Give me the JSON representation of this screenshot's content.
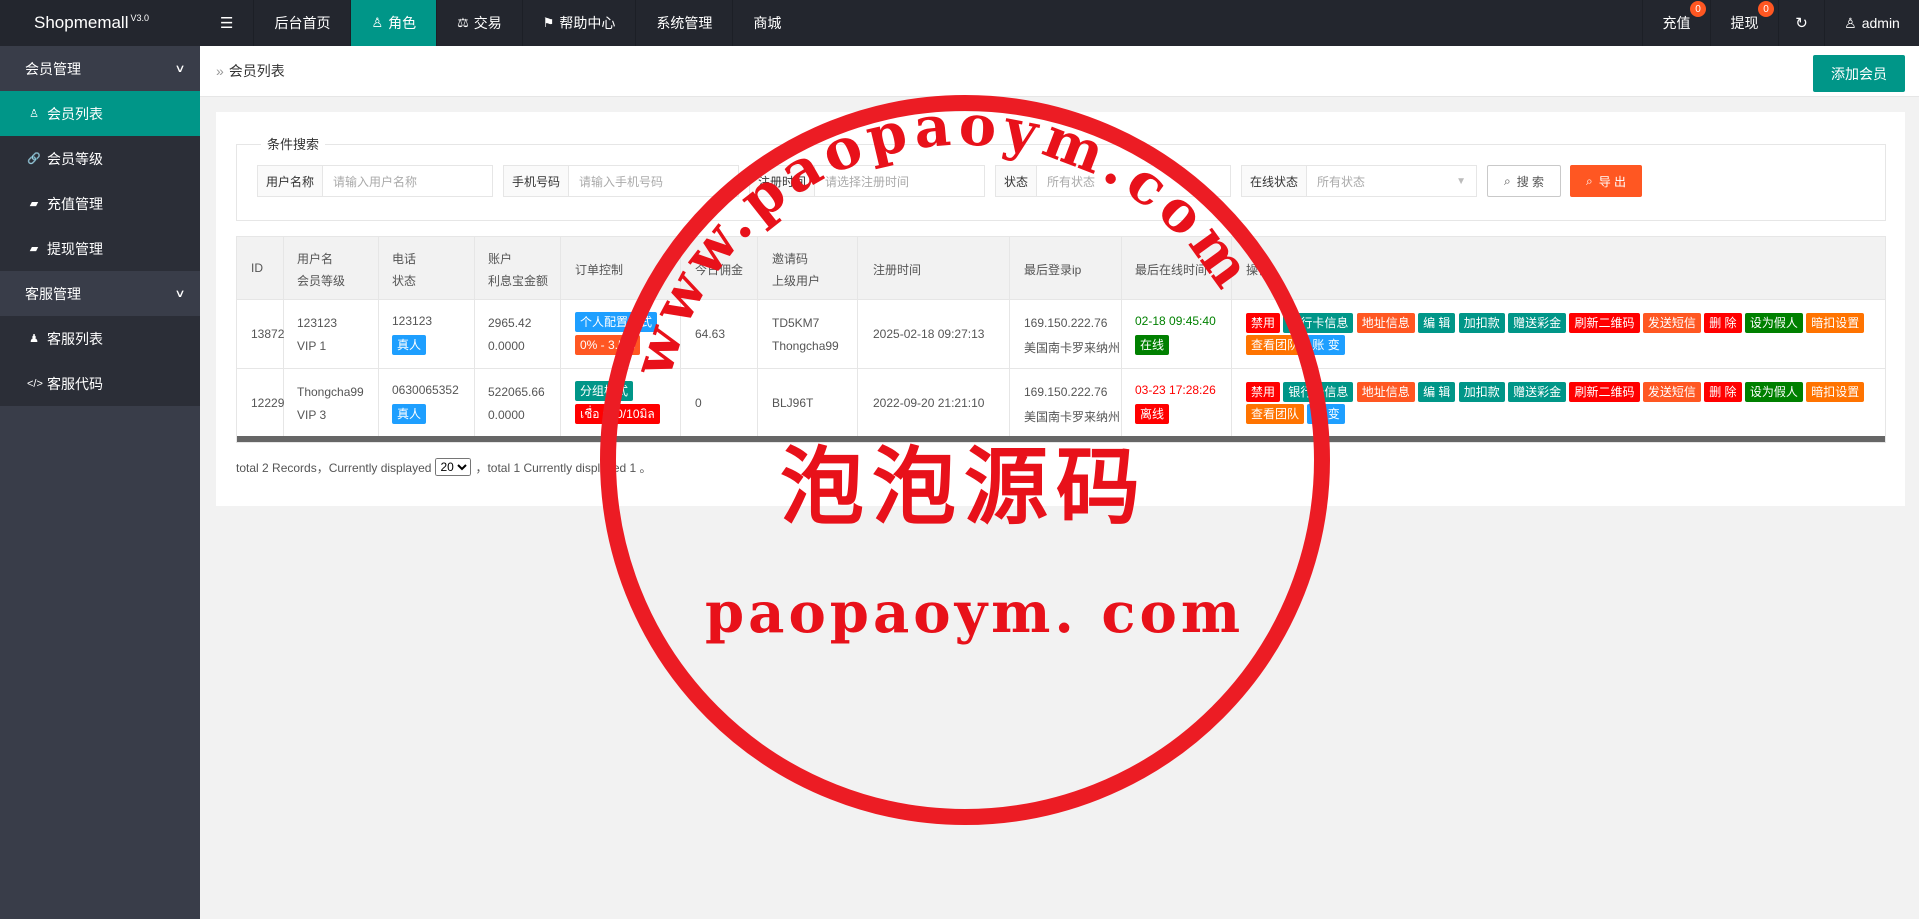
{
  "app": {
    "name": "Shopmemall",
    "version": "V3.0"
  },
  "topnav": {
    "menu_icon": "menu-icon",
    "items": [
      {
        "label": "后台首页"
      },
      {
        "label": "角色",
        "icon": "user-icon",
        "active": true
      },
      {
        "label": "交易",
        "icon": "scale-icon"
      },
      {
        "label": "帮助中心",
        "icon": "flag-icon"
      },
      {
        "label": "系统管理"
      },
      {
        "label": "商城"
      }
    ],
    "recharge": {
      "label": "充值",
      "badge": "0"
    },
    "withdraw": {
      "label": "提现",
      "badge": "0"
    },
    "refresh_icon": "refresh-icon",
    "user": {
      "label": "admin",
      "icon": "user-icon"
    }
  },
  "sidebar": {
    "groups": [
      {
        "label": "会员管理",
        "items": [
          {
            "label": "会员列表",
            "icon": "user-icon",
            "active": true
          },
          {
            "label": "会员等级",
            "icon": "link-icon"
          },
          {
            "label": "充值管理",
            "icon": "chat-icon"
          },
          {
            "label": "提现管理",
            "icon": "chat-icon"
          }
        ]
      },
      {
        "label": "客服管理",
        "items": [
          {
            "label": "客服列表",
            "icon": "users-icon"
          },
          {
            "label": "客服代码",
            "icon": "code-icon"
          }
        ]
      }
    ]
  },
  "breadcrumb": {
    "sep": "»",
    "label": "会员列表"
  },
  "add_button": "添加会员",
  "search": {
    "legend": "条件搜索",
    "username": {
      "label": "用户名称",
      "placeholder": "请输入用户名称"
    },
    "phone": {
      "label": "手机号码",
      "placeholder": "请输入手机号码"
    },
    "regtime": {
      "label": "注册时间",
      "placeholder": "请选择注册时间"
    },
    "status": {
      "label": "状态",
      "placeholder": "所有状态"
    },
    "online": {
      "label": "在线状态",
      "placeholder": "所有状态"
    },
    "search_btn": "搜 索",
    "export_btn": "导 出"
  },
  "table": {
    "headers": {
      "id": "ID",
      "user1": "用户名",
      "user2": "会员等级",
      "phone1": "电话",
      "phone2": "状态",
      "acct1": "账户",
      "acct2": "利息宝金额",
      "order": "订单控制",
      "today": "今日佣金",
      "invite1": "邀请码",
      "invite2": "上级用户",
      "regtime": "注册时间",
      "ip": "最后登录ip",
      "lastonline": "最后在线时间",
      "ops": "操作"
    },
    "rows": [
      {
        "id": "13872",
        "username": "123123",
        "level": "VIP 1",
        "phone": "123123",
        "status": "真人",
        "balance": "2965.42",
        "interest": "0.0000",
        "order_a": "个人配置模式",
        "order_b": "0% - 3.5%",
        "today": "64.63",
        "invite": "TD5KM7",
        "parent": "Thongcha99",
        "regtime": "2025-02-18 09:27:13",
        "ip": "169.150.222.76",
        "ip_loc": "美国南卡罗来纳州",
        "lastonline": "02-18 09:45:40",
        "online": "在线"
      },
      {
        "id": "12229",
        "username": "Thongcha99",
        "level": "VIP 3",
        "phone": "0630065352",
        "status": "真人",
        "balance": "522065.66",
        "interest": "0.0000",
        "order_a": "分组模式",
        "order_b": "เชื่อ 000/10มิล",
        "today": "0",
        "invite": "BLJ96T",
        "parent": "",
        "regtime": "2022-09-20 21:21:10",
        "ip": "169.150.222.76",
        "ip_loc": "美国南卡罗来纳州",
        "lastonline": "03-23 17:28:26",
        "online": "离线"
      }
    ],
    "ops": [
      "禁用",
      "银行卡信息",
      "地址信息",
      "编 辑",
      "加扣款",
      "赠送彩金",
      "刷新二维码",
      "发送短信",
      "删 除",
      "设为假人",
      "暗扣设置",
      "查看团队",
      "账 变"
    ]
  },
  "pager": {
    "text1": "total 2 Records，Currently displayed",
    "size": "20",
    "text2": "，total 1 Currently displayed 1 。"
  },
  "watermark": {
    "arc": "www.paopaoym.com",
    "cn": "泡泡源码",
    "url": "paopaoym. com"
  },
  "colors": {
    "topbar": "#23262e",
    "sidebar": "#393d49",
    "accent": "#009688",
    "orange": "#ff5722",
    "red": "#ff0000",
    "blue": "#1e9fff",
    "stamp": "#ec1c24"
  }
}
